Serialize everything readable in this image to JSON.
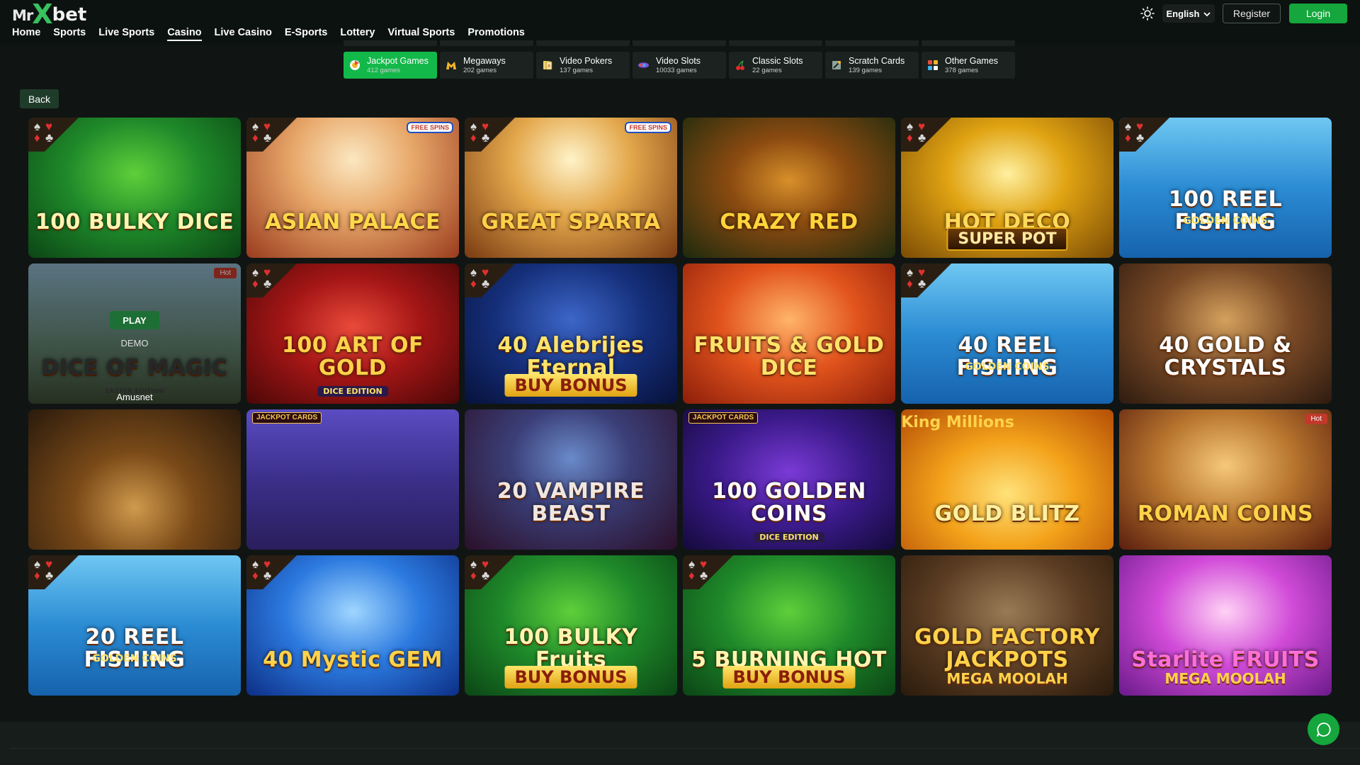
{
  "header": {
    "logo": {
      "mr": "Mr",
      "x": "X",
      "bet": "bet"
    },
    "nav": [
      {
        "label": "Home",
        "active": false
      },
      {
        "label": "Sports",
        "active": false
      },
      {
        "label": "Live Sports",
        "active": false
      },
      {
        "label": "Casino",
        "active": true
      },
      {
        "label": "Live Casino",
        "active": false
      },
      {
        "label": "E-Sports",
        "active": false
      },
      {
        "label": "Lottery",
        "active": false
      },
      {
        "label": "Virtual Sports",
        "active": false
      },
      {
        "label": "Promotions",
        "active": false
      }
    ],
    "language": "English",
    "register_label": "Register",
    "login_label": "Login",
    "accent_color": "#15a63d"
  },
  "categories": [
    {
      "name": "Jackpot Games",
      "count": "412 games",
      "icon": "jackpot-icon",
      "active": true
    },
    {
      "name": "Megaways",
      "count": "202 games",
      "icon": "megaways-icon",
      "active": false
    },
    {
      "name": "Video Pokers",
      "count": "137 games",
      "icon": "video-poker-icon",
      "active": false
    },
    {
      "name": "Video Slots",
      "count": "10033 games",
      "icon": "video-slots-icon",
      "active": false
    },
    {
      "name": "Classic Slots",
      "count": "22 games",
      "icon": "cherry-icon",
      "active": false
    },
    {
      "name": "Scratch Cards",
      "count": "139 games",
      "icon": "scratch-card-icon",
      "active": false
    },
    {
      "name": "Other Games",
      "count": "378 games",
      "icon": "other-games-icon",
      "active": false
    }
  ],
  "back_label": "Back",
  "hover_tile": {
    "play_label": "PLAY",
    "demo_label": "DEMO",
    "provider": "Amusnet"
  },
  "games": [
    {
      "title": "100 BULKY DICE",
      "sub": "",
      "bg": "green",
      "suits": true,
      "badge": ""
    },
    {
      "title": "ASIAN PALACE",
      "sub": "",
      "bg": "palace",
      "suits": true,
      "badge": "spins"
    },
    {
      "title": "GREAT SPARTA",
      "sub": "",
      "bg": "sparta",
      "suits": true,
      "badge": "spins"
    },
    {
      "title": "CRAZY RED",
      "sub": "",
      "bg": "jungle",
      "suits": false,
      "badge": ""
    },
    {
      "title": "HOT DECO",
      "sub": "SUPER POT",
      "bg": "gold",
      "suits": true,
      "badge": ""
    },
    {
      "title": "100 REEL FISHING",
      "sub": "GOLDEN COINS",
      "bg": "sea",
      "suits": true,
      "badge": ""
    },
    {
      "title": "DICE OF MAGIC",
      "sub": "EASTER EDITION",
      "bg": "easter",
      "suits": false,
      "badge": "hot"
    },
    {
      "title": "100 ART OF GOLD",
      "sub": "DICE EDITION",
      "bg": "red",
      "suits": true,
      "badge": ""
    },
    {
      "title": "40 Alebrijes Eternal",
      "sub": "BUY BONUS",
      "bg": "night",
      "suits": true,
      "badge": ""
    },
    {
      "title": "FRUITS & GOLD DICE",
      "sub": "",
      "bg": "orange",
      "suits": false,
      "badge": ""
    },
    {
      "title": "40 REEL FISHING",
      "sub": "GOLDEN COINS",
      "bg": "sea",
      "suits": true,
      "badge": ""
    },
    {
      "title": "40 GOLD & CRYSTALS",
      "sub": "",
      "bg": "cave",
      "suits": false,
      "badge": ""
    },
    {
      "title": "",
      "sub": "",
      "bg": "table",
      "suits": false,
      "badge": ""
    },
    {
      "title": "",
      "sub": "",
      "bg": "violet",
      "suits": false,
      "badge": "jackpot"
    },
    {
      "title": "20 VAMPIRE BEAST",
      "sub": "",
      "bg": "vampire",
      "suits": false,
      "badge": ""
    },
    {
      "title": "100 GOLDEN COINS",
      "sub": "DICE EDITION",
      "bg": "purple",
      "suits": false,
      "badge": "jackpot"
    },
    {
      "title": "GOLD BLITZ",
      "sub": "King Millions",
      "bg": "blitz",
      "suits": false,
      "badge": ""
    },
    {
      "title": "ROMAN COINS",
      "sub": "",
      "bg": "roman",
      "suits": false,
      "badge": "hot"
    },
    {
      "title": "20 REEL FISHING",
      "sub": "GOLDEN COINS",
      "bg": "sea",
      "suits": true,
      "badge": ""
    },
    {
      "title": "40 Mystic GEM",
      "sub": "",
      "bg": "blue",
      "suits": true,
      "badge": ""
    },
    {
      "title": "100 BULKY Fruits",
      "sub": "BUY BONUS",
      "bg": "green",
      "suits": true,
      "badge": ""
    },
    {
      "title": "5 BURNING HOT",
      "sub": "BUY BONUS",
      "bg": "green",
      "suits": true,
      "badge": ""
    },
    {
      "title": "GOLD FACTORY JACKPOTS",
      "sub": "MEGA MOOLAH",
      "bg": "factory",
      "suits": false,
      "badge": ""
    },
    {
      "title": "Starlite FRUITS",
      "sub": "MEGA MOOLAH",
      "bg": "starlite",
      "suits": false,
      "badge": ""
    }
  ],
  "badges": {
    "hot": "Hot",
    "spins": "FREE SPINS",
    "jackpot": "JACKPOT CARDS"
  }
}
